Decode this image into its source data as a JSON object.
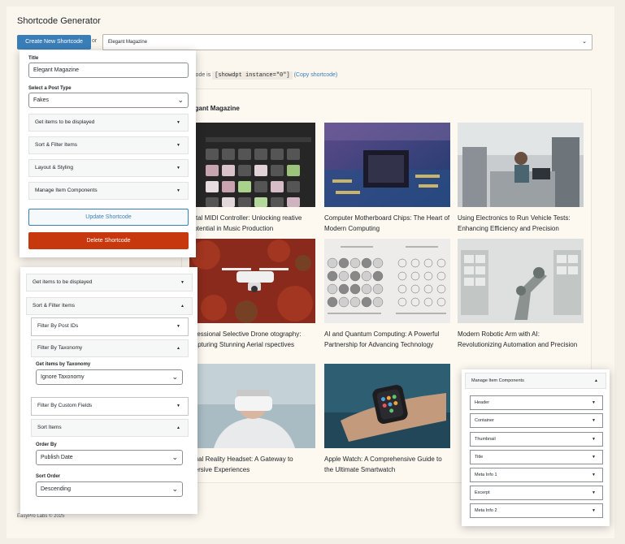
{
  "header": {
    "title": "Shortcode Generator",
    "create_button": "Create New Shortcode",
    "or_text": "or",
    "selected_instance": "Elegant Magazine"
  },
  "shortcode": {
    "prefix": "hortcode is",
    "code": "[showdpt instance=\"0\"]",
    "copy_link": "(Copy shortcode)"
  },
  "preview": {
    "title": "legant Magazine",
    "cards": [
      {
        "title": "igital MIDI Controller: Unlocking reative Potential in Music Production"
      },
      {
        "title": "Computer Motherboard Chips: The Heart of Modern Computing"
      },
      {
        "title": "Using Electronics to Run Vehicle Tests: Enhancing Efficiency and Precision"
      },
      {
        "title": "rofessional Selective Drone otography: Capturing Stunning Aerial rspectives"
      },
      {
        "title": "AI and Quantum Computing: A Powerful Partnership for Advancing Technology"
      },
      {
        "title": "Modern Robotic Arm with AI: Revolutionizing Automation and Precision"
      },
      {
        "title": "irtual Reality Headset: A Gateway to mersive Experiences"
      },
      {
        "title": "Apple Watch: A Comprehensive Guide to the Ultimate Smartwatch"
      }
    ]
  },
  "settings_panel": {
    "title_label": "Title",
    "title_value": "Elegant Magazine",
    "post_type_label": "Select a Post Type",
    "post_type_value": "Fakes",
    "sections": [
      "Get items to be displayed",
      "Sort & Filter Items",
      "Layout & Styling",
      "Manage Item Components"
    ],
    "update_button": "Update Shortcode",
    "delete_button": "Delete Shortcode"
  },
  "filter_panel": {
    "get_items": "Get items to be displayed",
    "sort_filter": "Sort & Filter Items",
    "filter_post_ids": "Filter By Post IDs",
    "filter_taxonomy": "Filter By Taxonomy",
    "get_by_taxonomy_label": "Get items by Taxonomy",
    "taxonomy_value": "Ignore Taxonomy",
    "filter_custom_fields": "Filter By Custom Fields",
    "sort_items": "Sort Items",
    "order_by_label": "Order By",
    "order_by_value": "Publish Date",
    "sort_order_label": "Sort Order",
    "sort_order_value": "Descending"
  },
  "components_panel": {
    "title": "Manage Item Components",
    "items": [
      "Header",
      "Container",
      "Thumbnail",
      "Title",
      "Meta Info 1",
      "Excerpt",
      "Meta Info 2"
    ]
  },
  "footer": {
    "text": "EasyPro Labs © 2025"
  }
}
